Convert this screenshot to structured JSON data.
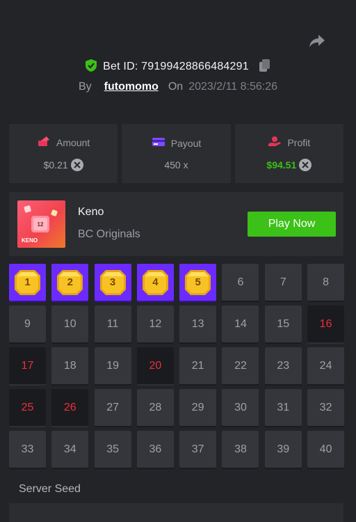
{
  "header": {
    "bet_id_label": "Bet ID:",
    "bet_id": "79199428866484291",
    "by_label": "By",
    "username": "futomomo",
    "on_label": "On",
    "date": "2023/2/11 8:56:26"
  },
  "stats": {
    "amount_label": "Amount",
    "amount_value": "$0.21",
    "payout_label": "Payout",
    "payout_value": "450 x",
    "profit_label": "Profit",
    "profit_value": "$94.51"
  },
  "game": {
    "thumb_label": "KENO",
    "thumb_number": "12",
    "name": "Keno",
    "provider": "BC Originals",
    "play_label": "Play Now"
  },
  "board": {
    "cells": [
      {
        "n": "1",
        "state": "picked"
      },
      {
        "n": "2",
        "state": "picked"
      },
      {
        "n": "3",
        "state": "picked"
      },
      {
        "n": "4",
        "state": "picked"
      },
      {
        "n": "5",
        "state": "picked"
      },
      {
        "n": "6",
        "state": "normal"
      },
      {
        "n": "7",
        "state": "normal"
      },
      {
        "n": "8",
        "state": "normal"
      },
      {
        "n": "9",
        "state": "normal"
      },
      {
        "n": "10",
        "state": "normal"
      },
      {
        "n": "11",
        "state": "normal"
      },
      {
        "n": "12",
        "state": "normal"
      },
      {
        "n": "13",
        "state": "normal"
      },
      {
        "n": "14",
        "state": "normal"
      },
      {
        "n": "15",
        "state": "normal"
      },
      {
        "n": "16",
        "state": "hit"
      },
      {
        "n": "17",
        "state": "hit"
      },
      {
        "n": "18",
        "state": "normal"
      },
      {
        "n": "19",
        "state": "normal"
      },
      {
        "n": "20",
        "state": "hit"
      },
      {
        "n": "21",
        "state": "normal"
      },
      {
        "n": "22",
        "state": "normal"
      },
      {
        "n": "23",
        "state": "normal"
      },
      {
        "n": "24",
        "state": "normal"
      },
      {
        "n": "25",
        "state": "hit"
      },
      {
        "n": "26",
        "state": "hit"
      },
      {
        "n": "27",
        "state": "normal"
      },
      {
        "n": "28",
        "state": "normal"
      },
      {
        "n": "29",
        "state": "normal"
      },
      {
        "n": "30",
        "state": "normal"
      },
      {
        "n": "31",
        "state": "normal"
      },
      {
        "n": "32",
        "state": "normal"
      },
      {
        "n": "33",
        "state": "normal"
      },
      {
        "n": "34",
        "state": "normal"
      },
      {
        "n": "35",
        "state": "normal"
      },
      {
        "n": "36",
        "state": "normal"
      },
      {
        "n": "37",
        "state": "normal"
      },
      {
        "n": "38",
        "state": "normal"
      },
      {
        "n": "39",
        "state": "normal"
      },
      {
        "n": "40",
        "state": "normal"
      }
    ]
  },
  "seed": {
    "label": "Server Seed"
  },
  "icons": {
    "share": "share-arrow-icon",
    "verified": "verified-shield-icon",
    "copy": "copy-icon",
    "amount": "amount-icon",
    "payout": "card-icon",
    "profit": "profit-icon",
    "currency": "x-coin-icon"
  },
  "colors": {
    "background": "#232427",
    "panel": "#2c2d31",
    "cell": "#35363b",
    "picked": "#6b2bff",
    "hit_text": "#ed2f3b",
    "accent_green": "#3bc117",
    "gem": "#f7c324"
  }
}
